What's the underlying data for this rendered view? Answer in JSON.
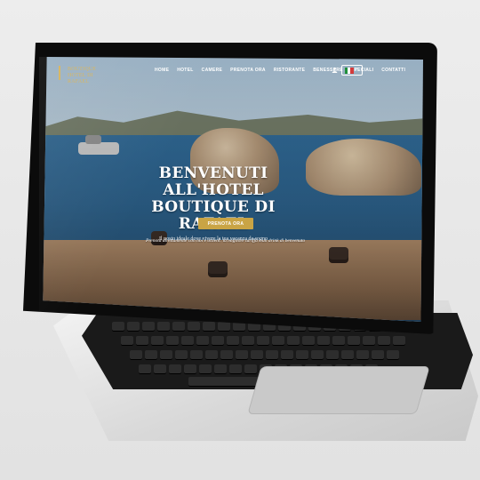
{
  "site": {
    "logo_text": "BOUTIQUE HOTEL DI RAFAEL",
    "nav": [
      "HOME",
      "HOTEL",
      "CAMERE",
      "PRENOTA ORA",
      "RISTORANTE",
      "BENESSERE",
      "SPECIALI",
      "CONTATTI"
    ],
    "language": "IT",
    "hero_title_line1": "BENVENUTI ALL'HOTEL",
    "hero_title_line2": "BOUTIQUE DI RAFAEL",
    "hero_subtitle": "Il posto ideale dove vivere la tua vacanza da sogno",
    "cta_label": "PRENOTA ORA",
    "tagline": "Prenota direttamente con noi e ottieni: la migliore tariffa e un drink di benvenuto"
  },
  "colors": {
    "accent_gold": "#c9a445",
    "logo_gold": "#d6b35a",
    "nav_text": "#ffffff",
    "laptop_silver": "#d9d9d9",
    "bezel": "#0b0b0b"
  },
  "icons": {
    "user": "user-icon",
    "flag": "flag-it-icon",
    "logo": "logo-icon"
  }
}
